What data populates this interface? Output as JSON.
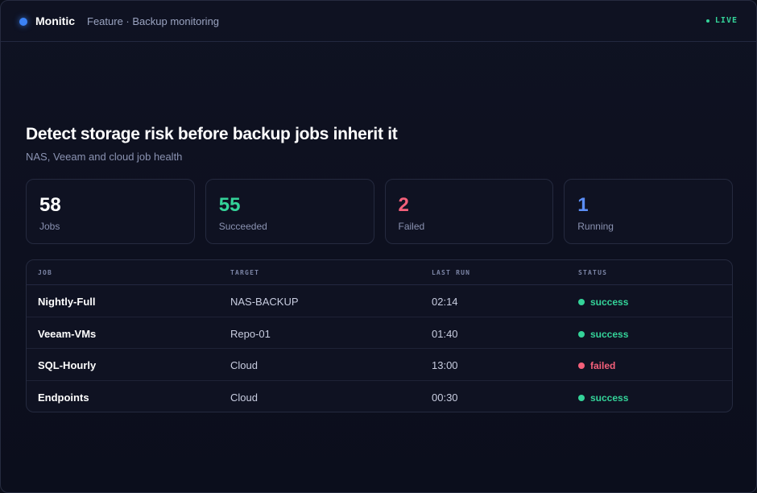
{
  "header": {
    "brand": "Monitic",
    "breadcrumb": "Feature · Backup monitoring",
    "live_label": "LIVE"
  },
  "hero": {
    "title": "Detect storage risk before backup jobs inherit it",
    "subtitle": "NAS, Veeam and cloud job health"
  },
  "stats": [
    {
      "value": "58",
      "label": "Jobs",
      "color": "#ffffff"
    },
    {
      "value": "55",
      "label": "Succeeded",
      "color": "#34d399"
    },
    {
      "value": "2",
      "label": "Failed",
      "color": "#f4607a"
    },
    {
      "value": "1",
      "label": "Running",
      "color": "#5b8ef7"
    }
  ],
  "table": {
    "columns": [
      "JOB",
      "TARGET",
      "LAST RUN",
      "STATUS"
    ],
    "rows": [
      {
        "job": "Nightly-Full",
        "target": "NAS-BACKUP",
        "last_run": "02:14",
        "status": "success"
      },
      {
        "job": "Veeam-VMs",
        "target": "Repo-01",
        "last_run": "01:40",
        "status": "success"
      },
      {
        "job": "SQL-Hourly",
        "target": "Cloud",
        "last_run": "13:00",
        "status": "failed"
      },
      {
        "job": "Endpoints",
        "target": "Cloud",
        "last_run": "00:30",
        "status": "success"
      }
    ]
  },
  "colors": {
    "accent": "#3b82f6",
    "success": "#34d399",
    "failed": "#f4607a",
    "running": "#5b8ef7"
  }
}
